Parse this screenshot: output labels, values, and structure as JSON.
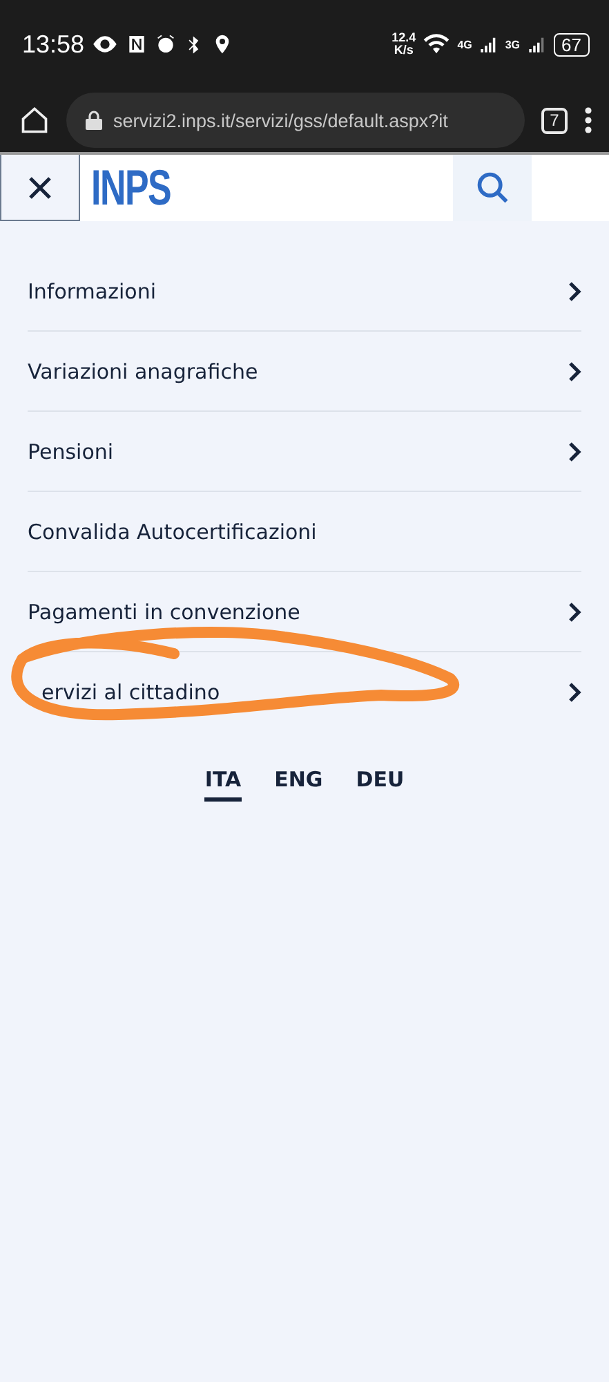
{
  "status_bar": {
    "time": "13:58",
    "speed_value": "12.4",
    "speed_unit": "K/s",
    "network_1": "4G",
    "network_2": "3G",
    "battery": "67"
  },
  "browser": {
    "url": "servizi2.inps.it/servizi/gss/default.aspx?it",
    "tab_count": "7"
  },
  "header": {
    "logo": "INPS"
  },
  "menu": [
    {
      "label": "Informazioni",
      "has_submenu": true
    },
    {
      "label": "Variazioni anagrafiche",
      "has_submenu": true
    },
    {
      "label": "Pensioni",
      "has_submenu": true
    },
    {
      "label": "Convalida Autocertificazioni",
      "has_submenu": false
    },
    {
      "label": "Pagamenti in convenzione",
      "has_submenu": true
    },
    {
      "label": "ervizi al cittadino",
      "has_submenu": true,
      "circled": true
    }
  ],
  "languages": [
    {
      "label": "ITA",
      "selected": true
    },
    {
      "label": "ENG",
      "selected": false
    },
    {
      "label": "DEU",
      "selected": false
    }
  ]
}
